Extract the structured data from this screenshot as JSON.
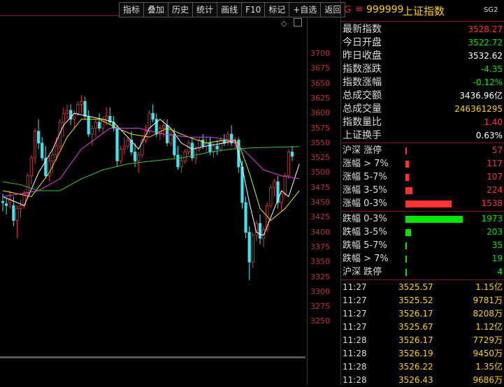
{
  "toolbar": [
    "指标",
    "叠加",
    "历史",
    "统计",
    "画线",
    "F10",
    "标记",
    "+自选",
    "返回"
  ],
  "y_axis_ticks": [
    "3700",
    "3675",
    "3650",
    "3625",
    "3600",
    "3575",
    "3550",
    "3525",
    "3500",
    "3475",
    "3450",
    "3425",
    "3400",
    "3375",
    "3350",
    "3325",
    "3300",
    "3275",
    "3250"
  ],
  "panel_header": {
    "g_mark": "G",
    "menu_icon": "≡",
    "code": "999999",
    "name": "上证指数",
    "sg": "SG2"
  },
  "colors": {
    "up": "#ff3232",
    "down": "#00e600",
    "flat": "#ffffff",
    "yellow": "#ffd200",
    "ma_white": "#ffffff",
    "ma_yellow": "#e8e800",
    "ma_magenta": "#e040e0",
    "ma_green": "#40c040",
    "up_candle": "#e03a3a",
    "down_candle": "#38e8f0",
    "border": "#7a1a1a"
  },
  "quote_rows": [
    {
      "label": "最新指数",
      "value": "3528.27",
      "color": "up"
    },
    {
      "label": "今日开盘",
      "value": "3522.72",
      "color": "down"
    },
    {
      "label": "昨日收盘",
      "value": "3532.62",
      "color": "flat"
    },
    {
      "label": "指数涨跌",
      "value": "-4.35",
      "color": "down"
    },
    {
      "label": "指数涨幅",
      "value": "-0.12%",
      "color": "down"
    },
    {
      "label": "总成交额",
      "value": "3436.96亿",
      "color": "flat"
    },
    {
      "label": "总成交量",
      "value": "246361295",
      "color": "yellow"
    },
    {
      "label": "指数量比",
      "value": "1.40",
      "color": "up"
    },
    {
      "label": "上证换手",
      "value": "0.63%",
      "color": "flat"
    }
  ],
  "breadth_up": [
    {
      "label": "沪深 涨停",
      "count": "57",
      "ratio": 0.03
    },
    {
      "label": "涨幅 > 7%",
      "count": "117",
      "ratio": 0.06
    },
    {
      "label": "涨幅 5-7%",
      "count": "107",
      "ratio": 0.055
    },
    {
      "label": "涨幅 3-5%",
      "count": "224",
      "ratio": 0.12
    },
    {
      "label": "涨幅 0-3%",
      "count": "1538",
      "ratio": 0.8
    }
  ],
  "breadth_down": [
    {
      "label": "跌幅 0-3%",
      "count": "1973",
      "ratio": 1.0
    },
    {
      "label": "跌幅 3-5%",
      "count": "203",
      "ratio": 0.1
    },
    {
      "label": "跌幅 5-7%",
      "count": "35",
      "ratio": 0.018
    },
    {
      "label": "跌幅 > 7%",
      "count": "19",
      "ratio": 0.01
    },
    {
      "label": "沪深 跌停",
      "count": "4",
      "ratio": 0.005
    }
  ],
  "ticks": [
    {
      "time": "11:27",
      "price": "3525.57",
      "vol": "1.15亿"
    },
    {
      "time": "11:27",
      "price": "3525.52",
      "vol": "9781万"
    },
    {
      "time": "11:27",
      "price": "3526.17",
      "vol": "8208万"
    },
    {
      "time": "11:27",
      "price": "3525.67",
      "vol": "1.12亿"
    },
    {
      "time": "11:28",
      "price": "3526.17",
      "vol": "7729万"
    },
    {
      "time": "11:28",
      "price": "3526.19",
      "vol": "9450万"
    },
    {
      "time": "11:28",
      "price": "3526.22",
      "vol": "1.35亿"
    },
    {
      "time": "11:28",
      "price": "3526.43",
      "vol": "9686万"
    }
  ],
  "chart_data": {
    "type": "candlestick",
    "y_range": [
      3260,
      3715
    ],
    "candles": [
      [
        3452,
        3465,
        3435,
        3450
      ],
      [
        3448,
        3458,
        3430,
        3445
      ],
      [
        3450,
        3470,
        3440,
        3455
      ],
      [
        3445,
        3460,
        3410,
        3420
      ],
      [
        3420,
        3445,
        3390,
        3440
      ],
      [
        3440,
        3455,
        3425,
        3445
      ],
      [
        3445,
        3470,
        3440,
        3465
      ],
      [
        3465,
        3500,
        3460,
        3495
      ],
      [
        3495,
        3530,
        3480,
        3525
      ],
      [
        3525,
        3575,
        3515,
        3570
      ],
      [
        3570,
        3590,
        3540,
        3550
      ],
      [
        3550,
        3560,
        3520,
        3525
      ],
      [
        3525,
        3545,
        3490,
        3495
      ],
      [
        3495,
        3530,
        3485,
        3520
      ],
      [
        3520,
        3540,
        3500,
        3530
      ],
      [
        3530,
        3560,
        3520,
        3545
      ],
      [
        3545,
        3590,
        3540,
        3585
      ],
      [
        3585,
        3610,
        3560,
        3600
      ],
      [
        3600,
        3615,
        3590,
        3605
      ],
      [
        3605,
        3615,
        3580,
        3590
      ],
      [
        3590,
        3605,
        3575,
        3600
      ],
      [
        3600,
        3620,
        3595,
        3615
      ],
      [
        3615,
        3630,
        3600,
        3620
      ],
      [
        3620,
        3628,
        3590,
        3595
      ],
      [
        3595,
        3605,
        3560,
        3565
      ],
      [
        3565,
        3580,
        3545,
        3575
      ],
      [
        3575,
        3590,
        3560,
        3585
      ],
      [
        3585,
        3600,
        3570,
        3575
      ],
      [
        3575,
        3595,
        3565,
        3590
      ],
      [
        3590,
        3610,
        3580,
        3595
      ],
      [
        3595,
        3610,
        3580,
        3585
      ],
      [
        3585,
        3595,
        3570,
        3575
      ],
      [
        3575,
        3580,
        3510,
        3520
      ],
      [
        3520,
        3545,
        3515,
        3540
      ],
      [
        3540,
        3560,
        3530,
        3545
      ],
      [
        3545,
        3560,
        3540,
        3555
      ],
      [
        3555,
        3570,
        3530,
        3535
      ],
      [
        3535,
        3550,
        3510,
        3520
      ],
      [
        3520,
        3535,
        3500,
        3530
      ],
      [
        3530,
        3560,
        3525,
        3555
      ],
      [
        3555,
        3580,
        3550,
        3570
      ],
      [
        3570,
        3605,
        3565,
        3600
      ],
      [
        3600,
        3615,
        3585,
        3590
      ],
      [
        3590,
        3600,
        3560,
        3565
      ],
      [
        3565,
        3580,
        3555,
        3575
      ],
      [
        3575,
        3590,
        3560,
        3580
      ],
      [
        3580,
        3590,
        3545,
        3550
      ],
      [
        3550,
        3570,
        3545,
        3565
      ],
      [
        3565,
        3575,
        3525,
        3530
      ],
      [
        3530,
        3545,
        3505,
        3510
      ],
      [
        3510,
        3530,
        3500,
        3520
      ],
      [
        3520,
        3540,
        3515,
        3535
      ],
      [
        3535,
        3555,
        3530,
        3550
      ],
      [
        3550,
        3560,
        3520,
        3525
      ],
      [
        3525,
        3545,
        3515,
        3540
      ],
      [
        3540,
        3560,
        3535,
        3555
      ],
      [
        3555,
        3565,
        3540,
        3545
      ],
      [
        3545,
        3560,
        3535,
        3550
      ],
      [
        3550,
        3560,
        3530,
        3535
      ],
      [
        3535,
        3550,
        3525,
        3545
      ],
      [
        3545,
        3555,
        3530,
        3540
      ],
      [
        3540,
        3560,
        3535,
        3555
      ],
      [
        3555,
        3565,
        3545,
        3550
      ],
      [
        3550,
        3570,
        3545,
        3565
      ],
      [
        3565,
        3580,
        3545,
        3550
      ],
      [
        3550,
        3560,
        3540,
        3555
      ],
      [
        3555,
        3560,
        3500,
        3510
      ],
      [
        3510,
        3520,
        3440,
        3450
      ],
      [
        3450,
        3460,
        3390,
        3400
      ],
      [
        3400,
        3410,
        3320,
        3350
      ],
      [
        3350,
        3400,
        3340,
        3395
      ],
      [
        3395,
        3420,
        3385,
        3415
      ],
      [
        3415,
        3430,
        3380,
        3390
      ],
      [
        3390,
        3410,
        3375,
        3405
      ],
      [
        3405,
        3450,
        3400,
        3445
      ],
      [
        3445,
        3480,
        3440,
        3475
      ],
      [
        3475,
        3490,
        3460,
        3485
      ],
      [
        3485,
        3495,
        3440,
        3450
      ],
      [
        3450,
        3470,
        3435,
        3465
      ],
      [
        3465,
        3500,
        3460,
        3495
      ],
      [
        3495,
        3540,
        3490,
        3535
      ],
      [
        3535,
        3545,
        3520,
        3528
      ]
    ],
    "ma": [
      {
        "name": "MA5",
        "color": "ma_white",
        "values": [
          [
            0,
            3460
          ],
          [
            6,
            3445
          ],
          [
            10,
            3500
          ],
          [
            14,
            3540
          ],
          [
            17,
            3580
          ],
          [
            20,
            3600
          ],
          [
            24,
            3595
          ],
          [
            28,
            3590
          ],
          [
            31,
            3585
          ],
          [
            35,
            3560
          ],
          [
            38,
            3540
          ],
          [
            41,
            3575
          ],
          [
            44,
            3590
          ],
          [
            47,
            3575
          ],
          [
            50,
            3550
          ],
          [
            53,
            3540
          ],
          [
            57,
            3545
          ],
          [
            62,
            3550
          ],
          [
            65,
            3555
          ],
          [
            67,
            3510
          ],
          [
            69,
            3450
          ],
          [
            71,
            3400
          ],
          [
            73,
            3395
          ],
          [
            76,
            3440
          ],
          [
            78,
            3470
          ],
          [
            80,
            3460
          ],
          [
            83,
            3515
          ]
        ]
      },
      {
        "name": "MA10",
        "color": "ma_yellow",
        "values": [
          [
            0,
            3470
          ],
          [
            8,
            3460
          ],
          [
            13,
            3500
          ],
          [
            18,
            3560
          ],
          [
            22,
            3590
          ],
          [
            27,
            3590
          ],
          [
            32,
            3575
          ],
          [
            36,
            3565
          ],
          [
            41,
            3560
          ],
          [
            46,
            3575
          ],
          [
            52,
            3560
          ],
          [
            57,
            3550
          ],
          [
            62,
            3555
          ],
          [
            66,
            3550
          ],
          [
            69,
            3500
          ],
          [
            72,
            3440
          ],
          [
            75,
            3420
          ],
          [
            79,
            3440
          ],
          [
            83,
            3470
          ]
        ]
      },
      {
        "name": "MA20",
        "color": "ma_magenta",
        "values": [
          [
            0,
            3460
          ],
          [
            10,
            3470
          ],
          [
            16,
            3490
          ],
          [
            22,
            3540
          ],
          [
            30,
            3575
          ],
          [
            38,
            3575
          ],
          [
            45,
            3565
          ],
          [
            52,
            3560
          ],
          [
            58,
            3560
          ],
          [
            64,
            3555
          ],
          [
            68,
            3535
          ],
          [
            73,
            3505
          ],
          [
            78,
            3495
          ],
          [
            83,
            3490
          ]
        ]
      },
      {
        "name": "MA60",
        "color": "ma_green",
        "values": [
          [
            0,
            3485
          ],
          [
            5,
            3480
          ],
          [
            10,
            3470
          ],
          [
            16,
            3470
          ],
          [
            22,
            3490
          ],
          [
            28,
            3505
          ],
          [
            35,
            3515
          ],
          [
            42,
            3520
          ],
          [
            50,
            3525
          ],
          [
            58,
            3535
          ],
          [
            64,
            3540
          ],
          [
            70,
            3542
          ],
          [
            76,
            3543
          ],
          [
            83,
            3544
          ]
        ]
      }
    ]
  }
}
